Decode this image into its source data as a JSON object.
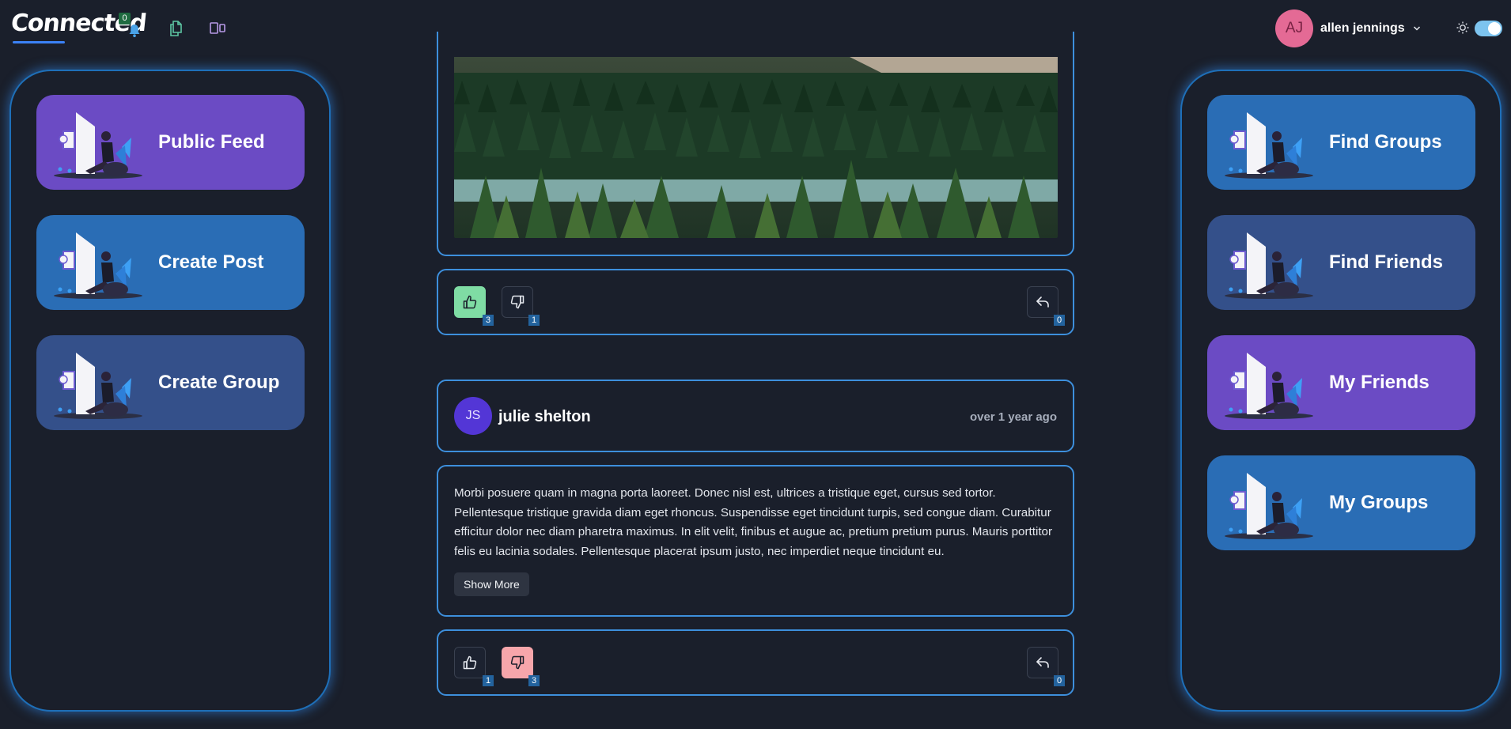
{
  "header": {
    "logo": "Connected",
    "notification_count": "0",
    "user": {
      "initials": "AJ",
      "name": "allen jennings"
    }
  },
  "left_nav": [
    {
      "label": "Public Feed"
    },
    {
      "label": "Create Post"
    },
    {
      "label": "Create Group"
    }
  ],
  "right_nav": [
    {
      "label": "Find Groups"
    },
    {
      "label": "Find Friends"
    },
    {
      "label": "My Friends"
    },
    {
      "label": "My Groups"
    }
  ],
  "feed": {
    "post1": {
      "likes": "3",
      "dislikes": "1",
      "replies": "0",
      "liked": true
    },
    "post2": {
      "author_initials": "JS",
      "author_name": "julie shelton",
      "time": "over 1 year ago",
      "body": "Morbi posuere quam in magna porta laoreet. Donec nisl est, ultrices a tristique eget, cursus sed tortor. Pellentesque tristique gravida diam eget rhoncus. Suspendisse eget tincidunt turpis, sed congue diam. Curabitur efficitur dolor nec diam pharetra maximus. In elit velit, finibus et augue ac, pretium pretium purus. Mauris porttitor felis eu lacinia sodales. Pellentesque placerat ipsum justo, nec imperdiet neque tincidunt eu.",
      "show_more_label": "Show More",
      "likes": "1",
      "dislikes": "3",
      "replies": "0",
      "disliked": true
    }
  },
  "colors": {
    "background": "#1a1f2b",
    "accent_blue": "#3d8fdc",
    "card_purple": "#6b4bc4",
    "card_blue": "#2a6db5",
    "card_navy": "#34508a",
    "like_active": "#7fdca4",
    "dislike_active": "#f7a6ab"
  },
  "icons": [
    "bell-icon",
    "documents-icon",
    "layout-icon",
    "chevron-down-icon",
    "sun-icon",
    "thumbs-up-icon",
    "thumbs-down-icon",
    "reply-icon"
  ]
}
